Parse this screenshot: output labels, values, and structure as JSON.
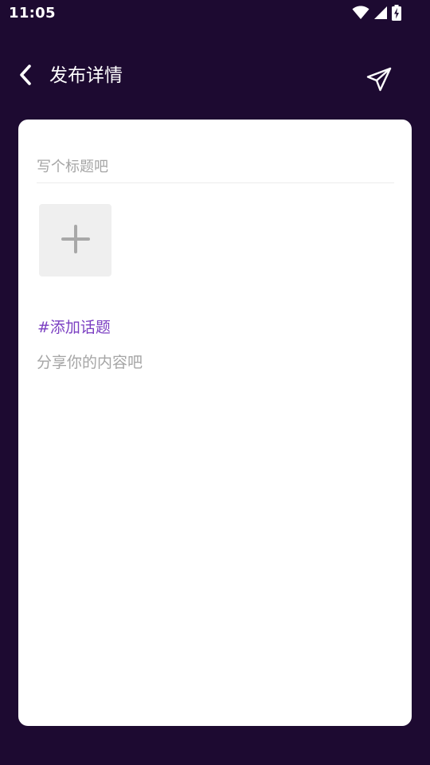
{
  "status_bar": {
    "time": "11:05",
    "icons": [
      "wifi-icon",
      "cellular-signal-icon",
      "battery-charging-icon"
    ]
  },
  "header": {
    "back_icon": "chevron-left-icon",
    "title": "发布详情",
    "send_icon": "paper-plane-send-icon"
  },
  "form": {
    "title_placeholder": "写个标题吧",
    "title_value": "",
    "add_image_icon": "plus-icon",
    "topic_link": "#添加话题",
    "content_placeholder": "分享你的内容吧",
    "content_value": ""
  },
  "colors": {
    "background": "#1d0a31",
    "card": "#ffffff",
    "accent": "#7b3fc2",
    "placeholder": "#a5a5a5",
    "image_tile": "#efefef"
  }
}
